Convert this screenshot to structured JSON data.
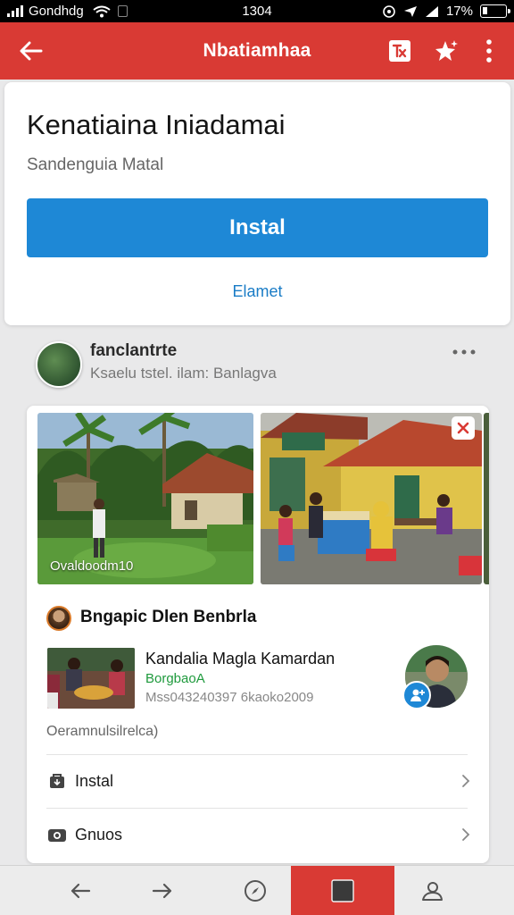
{
  "status_bar": {
    "carrier": "Gondhdg",
    "time": "1304",
    "battery": "17%"
  },
  "app_bar": {
    "title": "Nbatiamhaa",
    "icons": [
      "back-arrow-icon",
      "translate-icon",
      "star-sparkle-icon",
      "more-vert-icon"
    ]
  },
  "install_card": {
    "title": "Kenatiaina Iniadamai",
    "subtitle": "Sandenguia Matal",
    "install_button": "Instal",
    "secondary_link": "Elamet"
  },
  "profile": {
    "name": "fanclantrte",
    "meta": "Ksaelu tstel. ilam: Banlagva"
  },
  "feed_card": {
    "photos": [
      {
        "caption": "Ovaldoodm10"
      },
      {
        "caption": ""
      }
    ],
    "poster_name": "Bngapic Dlen Benbrla",
    "item": {
      "title": "Kandalia Magla Kamardan",
      "subtitle": "BorgbaoA",
      "meta": "Mss043240397 6kaoko2009"
    },
    "footnote": "Oeramnulsilrelca)",
    "list": [
      {
        "label": "Instal",
        "icon": "install-box-icon"
      },
      {
        "label": "Gnuos",
        "icon": "camera-icon"
      }
    ]
  },
  "bottom_nav": {
    "icons": [
      "nav-back-icon",
      "nav-forward-icon",
      "compass-icon",
      "tabs-square-icon",
      "profile-icon"
    ],
    "active_index": 3
  },
  "colors": {
    "brand_red": "#d93a34",
    "primary_blue": "#1e88d6",
    "link_blue": "#1a7cc6",
    "accent_green": "#1f9a3d"
  }
}
